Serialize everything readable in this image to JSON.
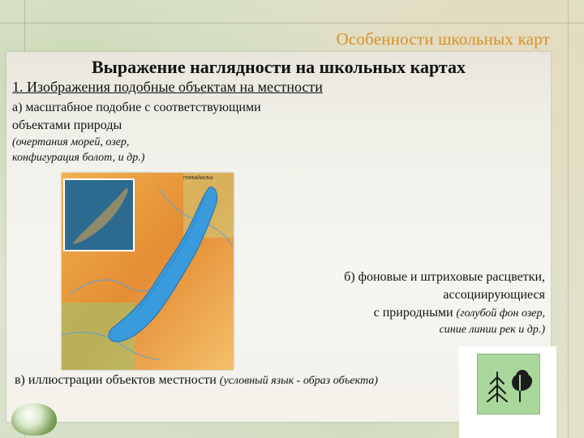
{
  "slide": {
    "title": "Особенности школьных карт",
    "heading": "Выражение наглядности на школьных картах",
    "item1": "1. Изображения подобные объектам на местности",
    "a_line1": "а) масштабное подобие с соответствующими",
    "a_line2": "объектами природы",
    "a_note1": "(очертания морей, озер,",
    "a_note2": "конфигурация болот, и др.)",
    "b_line1": "б) фоновые и штриховые расцветки,",
    "b_line2": "ассоциирующиеся",
    "b_line3_main": "с природными",
    "b_line3_note": "(голубой фон озер,",
    "b_line4": "синие линии рек и др.)",
    "v_main": "в) иллюстрации объектов местности",
    "v_note": "(условный язык - образ объекта)"
  },
  "map": {
    "label": "ПРИБАЙКАЛЬЕ"
  },
  "colors": {
    "title": "#d9902a",
    "lake": "#3a9bdc",
    "land": "#e79a3c",
    "symbol_bg": "#a9d79b"
  }
}
